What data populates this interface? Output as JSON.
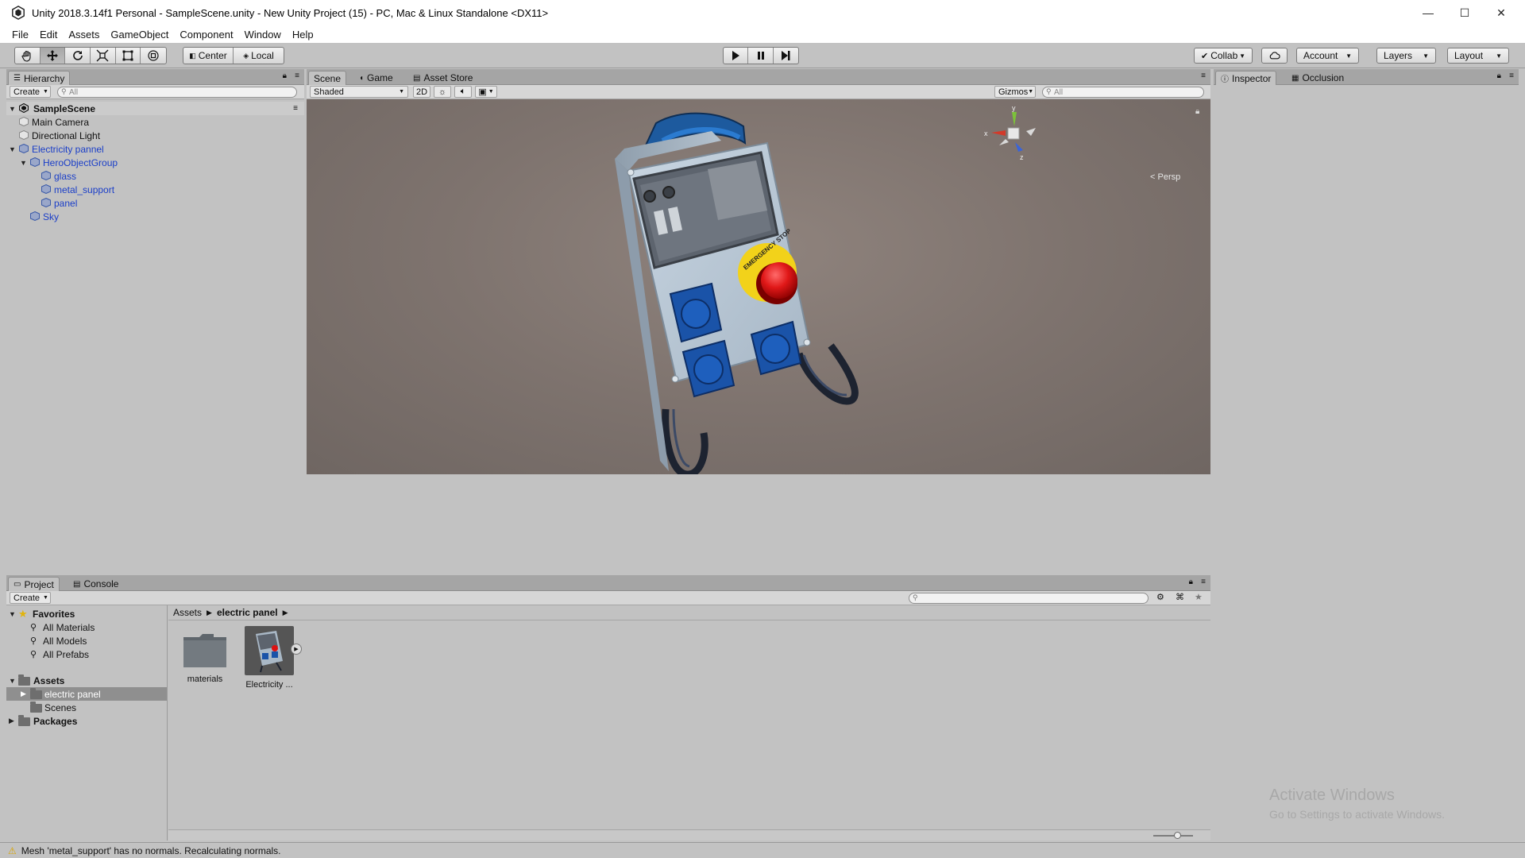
{
  "window": {
    "title": "Unity 2018.3.14f1 Personal - SampleScene.unity - New Unity Project (15) - PC, Mac & Linux Standalone <DX11>",
    "minimize": "—",
    "maximize": "☐",
    "close": "✕"
  },
  "menu": [
    "File",
    "Edit",
    "Assets",
    "GameObject",
    "Component",
    "Window",
    "Help"
  ],
  "toolbar": {
    "pivot_center": "Center",
    "pivot_local": "Local",
    "collab": "Collab",
    "account": "Account",
    "layers": "Layers",
    "layout": "Layout"
  },
  "hierarchy": {
    "tab": "Hierarchy",
    "create": "Create",
    "search_placeholder": "All",
    "scene": "SampleScene",
    "items": [
      {
        "label": "Main Camera",
        "depth": 1,
        "prefab": false
      },
      {
        "label": "Directional Light",
        "depth": 1,
        "prefab": false
      },
      {
        "label": "Electricity pannel",
        "depth": 1,
        "prefab": true
      },
      {
        "label": "HeroObjectGroup",
        "depth": 2,
        "prefab": true
      },
      {
        "label": "glass",
        "depth": 3,
        "prefab": true
      },
      {
        "label": "metal_support",
        "depth": 3,
        "prefab": true
      },
      {
        "label": "panel",
        "depth": 3,
        "prefab": true
      },
      {
        "label": "Sky",
        "depth": 2,
        "prefab": true
      }
    ]
  },
  "scene_view": {
    "tabs": [
      "Scene",
      "Game",
      "Asset Store"
    ],
    "shading": "Shaded",
    "mode_2d": "2D",
    "gizmos": "Gizmos",
    "search_placeholder": "All",
    "projection": "Persp",
    "axis_x": "x",
    "axis_y": "y",
    "axis_z": "z",
    "model_label": "EMERGENCY STOP"
  },
  "inspector": {
    "tabs": [
      "Inspector",
      "Occlusion"
    ],
    "watermark_title": "Activate Windows",
    "watermark_sub": "Go to Settings to activate Windows."
  },
  "project": {
    "tabs": [
      "Project",
      "Console"
    ],
    "create": "Create",
    "favorites_header": "Favorites",
    "favorites": [
      "All Materials",
      "All Models",
      "All Prefabs"
    ],
    "assets_header": "Assets",
    "assets_children": [
      "electric panel",
      "Scenes"
    ],
    "packages_header": "Packages",
    "breadcrumb": [
      "Assets",
      "electric panel"
    ],
    "grid_items": [
      "materials",
      "Electricity ..."
    ]
  },
  "status": {
    "message": "Mesh 'metal_support' has no normals. Recalculating normals."
  },
  "colors": {
    "selection": "#8f8f8f",
    "prefab_text": "#1a3ec8",
    "panel_bg": "#c2c2c2",
    "scene_bg": "#7e736e"
  }
}
